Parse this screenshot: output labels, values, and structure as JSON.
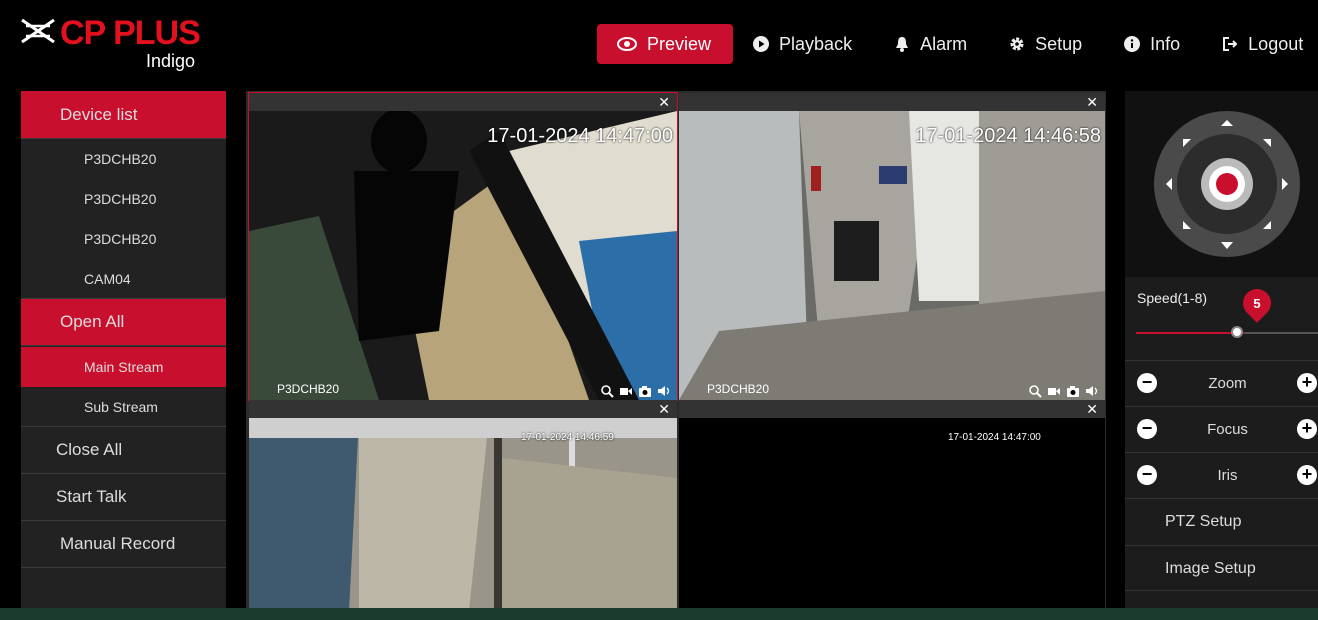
{
  "brand": {
    "logo_text": "CP PLUS",
    "logo_sub": "Indigo"
  },
  "nav": [
    {
      "label": "Preview",
      "icon": "eye-icon",
      "active": true
    },
    {
      "label": "Playback",
      "icon": "play-icon"
    },
    {
      "label": "Alarm",
      "icon": "bell-icon"
    },
    {
      "label": "Setup",
      "icon": "gear-icon"
    },
    {
      "label": "Info",
      "icon": "info-icon"
    },
    {
      "label": "Logout",
      "icon": "logout-icon"
    }
  ],
  "left_panel": {
    "device_list_label": "Device list",
    "devices": [
      "P3DCHB20",
      "P3DCHB20",
      "P3DCHB20",
      "CAM04"
    ],
    "open_all": "Open All",
    "main_stream": "Main Stream",
    "sub_stream": "Sub Stream",
    "close_all": "Close All",
    "start_talk": "Start Talk",
    "manual_record": "Manual Record"
  },
  "video_cells": [
    {
      "timestamp": "17-01-2024 14:47:00",
      "camera_name": "P3DCHB20"
    },
    {
      "timestamp": "17-01-2024 14:46:58",
      "camera_name": "P3DCHB20"
    },
    {
      "timestamp": "17-01-2024 14:46:59",
      "camera_name": ""
    },
    {
      "timestamp": "17-01-2024 14:47:00",
      "camera_name": ""
    }
  ],
  "ptz": {
    "speed_label": "Speed(1-8)",
    "speed_value": "5",
    "speed_fraction": 0.57,
    "zoom_label": "Zoom",
    "focus_label": "Focus",
    "iris_label": "Iris",
    "ptz_setup": "PTZ Setup",
    "image_setup": "Image Setup"
  },
  "colors": {
    "accent": "#c8102e",
    "background": "#000000",
    "panel": "#222222"
  }
}
